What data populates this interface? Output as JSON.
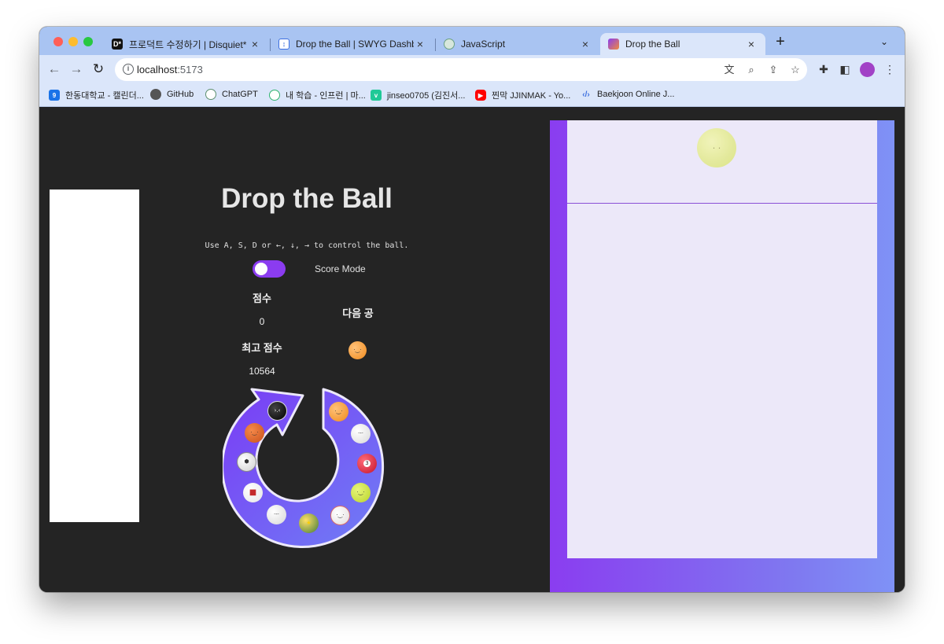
{
  "browser": {
    "tabs": [
      {
        "title": "프로덕트 수정하기 | Disquiet*",
        "favicon": "D*",
        "active": false
      },
      {
        "title": "Drop the Ball | SWYG Dashboa",
        "favicon": "S",
        "active": false
      },
      {
        "title": "JavaScript",
        "favicon": "gpt",
        "active": false
      },
      {
        "title": "Drop the Ball",
        "favicon": "app",
        "active": true
      }
    ],
    "new_tab_label": "+",
    "url_host": "localhost",
    "url_port": ":5173",
    "bookmarks": [
      {
        "label": "한동대학교 - 캘린더...",
        "icon": "calendar-icon"
      },
      {
        "label": "GitHub",
        "icon": "github-icon"
      },
      {
        "label": "ChatGPT",
        "icon": "chatgpt-icon"
      },
      {
        "label": "내 학습 - 인프런 | 마...",
        "icon": "inflearn-icon"
      },
      {
        "label": "jinseo0705 (김진서...",
        "icon": "velog-icon"
      },
      {
        "label": "찐막 JJINMAK - Yo...",
        "icon": "youtube-icon"
      },
      {
        "label": "Baekjoon Online J...",
        "icon": "code-icon"
      }
    ]
  },
  "game": {
    "title": "Drop the Ball",
    "hint": "Use A, S, D or ←, ↓, →  to control the ball.",
    "mode_label": "Score Mode",
    "mode_on": true,
    "score_label": "점수",
    "score_value": "0",
    "best_label": "최고 점수",
    "best_value": "10564",
    "next_label": "다음 공",
    "next_ball": "orange-ball",
    "cycle_balls": [
      "black-ball",
      "orange-ball",
      "white-ball",
      "billiard-ball",
      "tennis-ball",
      "baseball",
      "star-ball",
      "volleyball",
      "red-cap-ball",
      "soccer-ball",
      "basketball"
    ],
    "board_current_ball": "tennis-ball"
  },
  "colors": {
    "background": "#242424",
    "accent": "#8b3cf0",
    "board": "#ece8f9",
    "tab_strip": "#a9c4f2",
    "toolbar": "#dbe6fa"
  }
}
